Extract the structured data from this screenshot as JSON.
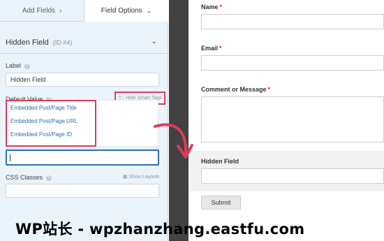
{
  "tabs": [
    {
      "label": "Add Fields",
      "icon": "chevron-right-icon",
      "glyph": "›"
    },
    {
      "label": "Field Options",
      "icon": "chevron-down-icon",
      "glyph": "⌄"
    }
  ],
  "field": {
    "title": "Hidden Field",
    "id": "(ID #4)"
  },
  "label_section": {
    "label": "Label",
    "value": "Hidden Field"
  },
  "default_value": {
    "label": "Default Value",
    "hide_smart_tags": "Hide Smart Tags",
    "smart_tags": [
      "Embedded Post/Page Title",
      "Embedded Post/Page URL",
      "Embedded Post/Page ID"
    ],
    "value": ""
  },
  "css_classes": {
    "label": "CSS Classes",
    "show_layouts": "Show Layouts",
    "value": ""
  },
  "preview": {
    "fields": [
      {
        "label": "Name",
        "required": "*"
      },
      {
        "label": "Email",
        "required": "*"
      },
      {
        "label": "Comment or Message",
        "required": "*"
      },
      {
        "label": "Hidden Field",
        "required": ""
      }
    ],
    "submit_label": "Submit"
  },
  "colors": {
    "highlight": "#e03a5c",
    "link": "#2a6eb3",
    "panel_bg": "#ebf3fb"
  },
  "watermark": "WP站长 - wpzhanzhang.eastfu.com"
}
